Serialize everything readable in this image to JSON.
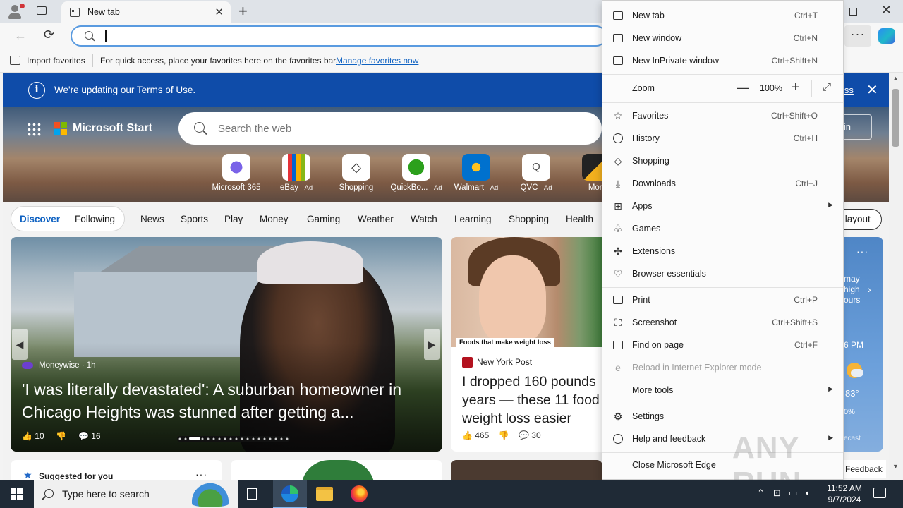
{
  "browser": {
    "tab_title": "New tab",
    "address_value": "",
    "favorites_bar": {
      "import_label": "Import favorites",
      "hint": "For quick access, place your favorites here on the favorites bar.",
      "manage_link": "Manage favorites now"
    }
  },
  "page": {
    "banner": {
      "text": "We're updating our Terms of Use.",
      "dismiss_label": "iss"
    },
    "brand": "Microsoft Start",
    "search_placeholder": "Search the web",
    "signin_label": "n in",
    "tiles": [
      {
        "label": "Microsoft 365",
        "ad": ""
      },
      {
        "label": "eBay",
        "ad": "· Ad"
      },
      {
        "label": "Shopping",
        "ad": ""
      },
      {
        "label": "QuickBo...",
        "ad": "· Ad"
      },
      {
        "label": "Walmart",
        "ad": "· Ad"
      },
      {
        "label": "QVC",
        "ad": "· Ad"
      },
      {
        "label": "Mon",
        "ad": ""
      }
    ],
    "feed_tabs": {
      "discover": "Discover",
      "following": "Following",
      "categories": [
        "News",
        "Sports",
        "Play",
        "Money",
        "Gaming",
        "Weather",
        "Watch",
        "Learning",
        "Shopping",
        "Health"
      ]
    },
    "layout_label": "l layout",
    "main_story": {
      "source": "Moneywise · 1h",
      "headline": "'I was literally devastated': A suburban homeowner in Chicago Heights was stunned after getting a...",
      "likes": "10",
      "comments": "16"
    },
    "second_story": {
      "image_caption": "Foods that make weight loss",
      "source": "New York Post",
      "headline": "I dropped 160 pounds\nyears — these 11 food\nweight loss easier",
      "likes": "465",
      "comments": "30"
    },
    "weather": {
      "text": "may\nhigh\nours",
      "time": "6 PM",
      "temp": "83°",
      "rain": "0%",
      "forecast": "ecast"
    },
    "suggested_label": "Suggested for you",
    "feedback_label": "Feedback"
  },
  "menu": {
    "items_top": [
      {
        "label": "New tab",
        "shortcut": "Ctrl+T",
        "icon": "new-tab-icon"
      },
      {
        "label": "New window",
        "shortcut": "Ctrl+N",
        "icon": "new-window-icon"
      },
      {
        "label": "New InPrivate window",
        "shortcut": "Ctrl+Shift+N",
        "icon": "inprivate-icon"
      }
    ],
    "zoom": {
      "label": "Zoom",
      "value": "100%"
    },
    "items_mid": [
      {
        "label": "Favorites",
        "shortcut": "Ctrl+Shift+O",
        "icon": "favorites-icon"
      },
      {
        "label": "History",
        "shortcut": "Ctrl+H",
        "icon": "history-icon"
      },
      {
        "label": "Shopping",
        "shortcut": "",
        "icon": "shopping-tag-icon"
      },
      {
        "label": "Downloads",
        "shortcut": "Ctrl+J",
        "icon": "download-icon"
      },
      {
        "label": "Apps",
        "shortcut": "",
        "icon": "apps-icon"
      },
      {
        "label": "Games",
        "shortcut": "",
        "icon": "games-icon"
      },
      {
        "label": "Extensions",
        "shortcut": "",
        "icon": "extensions-icon"
      },
      {
        "label": "Browser essentials",
        "shortcut": "",
        "icon": "heart-pulse-icon"
      }
    ],
    "items_tools": [
      {
        "label": "Print",
        "shortcut": "Ctrl+P",
        "icon": "print-icon"
      },
      {
        "label": "Screenshot",
        "shortcut": "Ctrl+Shift+S",
        "icon": "screenshot-icon"
      },
      {
        "label": "Find on page",
        "shortcut": "Ctrl+F",
        "icon": "find-icon"
      },
      {
        "label": "Reload in Internet Explorer mode",
        "shortcut": "",
        "icon": "ie-mode-icon"
      },
      {
        "label": "More tools",
        "shortcut": "",
        "icon": ""
      }
    ],
    "items_bottom": [
      {
        "label": "Settings",
        "shortcut": "",
        "icon": "settings-gear-icon"
      },
      {
        "label": "Help and feedback",
        "shortcut": "",
        "icon": "help-icon"
      },
      {
        "label": "Close Microsoft Edge",
        "shortcut": "",
        "icon": ""
      }
    ]
  },
  "taskbar": {
    "search_placeholder": "Type here to search",
    "time": "11:52 AM",
    "date": "9/7/2024"
  },
  "watermark": "ANY RUN"
}
